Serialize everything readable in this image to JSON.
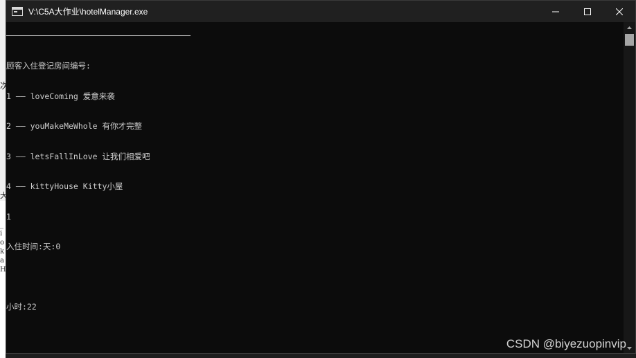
{
  "window": {
    "title": "V:\\C5A大作业\\hotelManager.exe",
    "controls": {
      "minimize": "minimize-icon",
      "maximize": "maximize-icon",
      "close": "close-icon"
    }
  },
  "console": {
    "lines": [
      "顾客入住登记房间编号:",
      "1 —— loveComing 爱意来袭",
      "2 —— youMakeMeWhole 有你才完整",
      "3 —— letsFallInLove 让我们相爱吧",
      "4 —— kittyHouse Kitty小屋",
      "1",
      "入住时间:天:0",
      "",
      "小时:22"
    ]
  },
  "background_window": {
    "glyph_top": "次",
    "glyph_mid": "大",
    "glyphs": [
      "_",
      "i",
      "o",
      "k",
      "a",
      "H"
    ]
  },
  "watermark": "CSDN @biyezuopinvip",
  "colors": {
    "console_bg": "#0c0c0c",
    "title_bar_bg": "#202020",
    "console_text": "#cccccc",
    "scroll_thumb": "#a6a6a6"
  }
}
